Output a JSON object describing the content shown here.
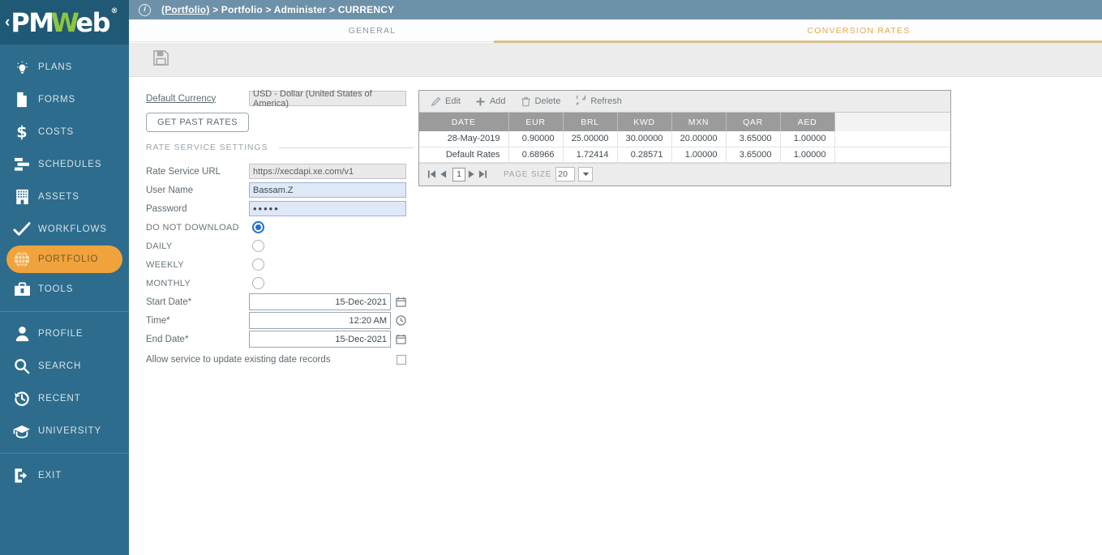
{
  "brand": {
    "chevron": "‹",
    "name_pm": "PM",
    "name_w": "W",
    "name_eb": "eb",
    "registered": "®",
    "accent_orange": "#f0a33c",
    "accent_green": "#8dc63f",
    "sidebar_blue": "#2d6c8c",
    "topbar_blue": "#6d91a8",
    "tab_gold": "#e2a94e"
  },
  "topbar": {
    "info_glyph": "i",
    "breadcrumb_link": "(Portfolio)",
    "breadcrumb_rest": " > Portfolio > Administer > CURRENCY"
  },
  "tabs": [
    {
      "label": "GENERAL",
      "active": false
    },
    {
      "label": "CONVERSION RATES",
      "active": true
    }
  ],
  "toolbar": {
    "save_label": "Save"
  },
  "sidebar": {
    "groups": [
      {
        "items": [
          {
            "label": "PLANS",
            "icon": "lightbulb-icon",
            "active": false
          },
          {
            "label": "FORMS",
            "icon": "document-icon",
            "active": false
          },
          {
            "label": "COSTS",
            "icon": "dollar-icon",
            "active": false
          },
          {
            "label": "SCHEDULES",
            "icon": "gantt-icon",
            "active": false
          },
          {
            "label": "ASSETS",
            "icon": "building-icon",
            "active": false
          },
          {
            "label": "WORKFLOWS",
            "icon": "check-icon",
            "active": false
          },
          {
            "label": "PORTFOLIO",
            "icon": "globe-icon",
            "active": true
          },
          {
            "label": "TOOLS",
            "icon": "toolbox-icon",
            "active": false
          }
        ]
      },
      {
        "items": [
          {
            "label": "PROFILE",
            "icon": "person-icon",
            "active": false
          },
          {
            "label": "SEARCH",
            "icon": "search-icon",
            "active": false
          },
          {
            "label": "RECENT",
            "icon": "history-icon",
            "active": false
          },
          {
            "label": "UNIVERSITY",
            "icon": "graduation-cap-icon",
            "active": false
          }
        ]
      },
      {
        "items": [
          {
            "label": "EXIT",
            "icon": "exit-icon",
            "active": false
          }
        ]
      }
    ]
  },
  "form": {
    "default_currency_label": "Default Currency",
    "default_currency_value": "USD - Dollar (United States of America)",
    "get_past_rates_label": "GET PAST RATES",
    "section_header": "RATE SERVICE SETTINGS",
    "rate_service_url_label": "Rate Service URL",
    "rate_service_url_value": "https://xecdapi.xe.com/v1",
    "user_name_label": "User Name",
    "user_name_value": "Bassam.Z",
    "password_label": "Password",
    "password_value": "•••••",
    "frequency": [
      {
        "label": "DO NOT DOWNLOAD",
        "checked": true
      },
      {
        "label": "DAILY",
        "checked": false
      },
      {
        "label": "WEEKLY",
        "checked": false
      },
      {
        "label": "MONTHLY",
        "checked": false
      }
    ],
    "start_date_label": "Start Date*",
    "start_date_value": "15-Dec-2021",
    "time_label": "Time*",
    "time_value": "12:20 AM",
    "end_date_label": "End Date*",
    "end_date_value": "15-Dec-2021",
    "allow_update_label": "Allow service to update existing date records",
    "allow_update_checked": false
  },
  "grid": {
    "toolbar": [
      {
        "label": "Edit",
        "icon": "pencil-icon"
      },
      {
        "label": "Add",
        "icon": "plus-icon"
      },
      {
        "label": "Delete",
        "icon": "trash-icon"
      },
      {
        "label": "Refresh",
        "icon": "refresh-icon"
      }
    ],
    "columns": [
      "DATE",
      "EUR",
      "BRL",
      "KWD",
      "MXN",
      "QAR",
      "AED"
    ],
    "rows": [
      {
        "date": "28-May-2019",
        "values": [
          "0.90000",
          "25.00000",
          "30.00000",
          "20.00000",
          "3.65000",
          "1.00000"
        ]
      },
      {
        "date": "Default Rates",
        "values": [
          "0.68966",
          "1.72414",
          "0.28571",
          "1.00000",
          "3.65000",
          "1.00000"
        ]
      }
    ],
    "pager": {
      "page": "1",
      "page_size_label": "PAGE SIZE",
      "page_size_value": "20"
    }
  }
}
